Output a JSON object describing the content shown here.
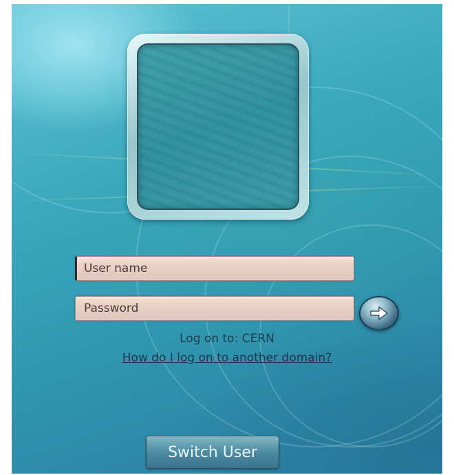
{
  "login": {
    "username_placeholder": "User name",
    "password_placeholder": "Password",
    "submit_icon": "arrow-right-icon",
    "logon_to": "Log on to: CERN",
    "domain_help_link": "How do I log on to another domain?"
  },
  "footer": {
    "switch_user_label": "Switch User"
  },
  "colors": {
    "background": "#2f98b0",
    "field_fill": "#ead0c2",
    "link_text": "#16384a"
  }
}
